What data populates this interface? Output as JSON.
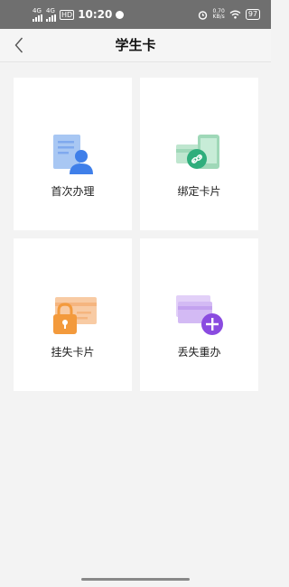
{
  "status_bar": {
    "sim1": "4G",
    "sim2": "4G",
    "hd": "HD",
    "time": "10:20",
    "speed_value": "0.70",
    "speed_unit": "KB/s",
    "battery": "97"
  },
  "header": {
    "title": "学生卡"
  },
  "cards": [
    {
      "label": "首次办理",
      "icon": "id-document-person-icon"
    },
    {
      "label": "绑定卡片",
      "icon": "phone-card-link-icon"
    },
    {
      "label": "挂失卡片",
      "icon": "card-lock-icon"
    },
    {
      "label": "丢失重办",
      "icon": "card-add-icon"
    }
  ],
  "colors": {
    "blue": "#3f7fe9",
    "green": "#2fae7c",
    "orange": "#f39a3c",
    "purple": "#8a4be0"
  }
}
